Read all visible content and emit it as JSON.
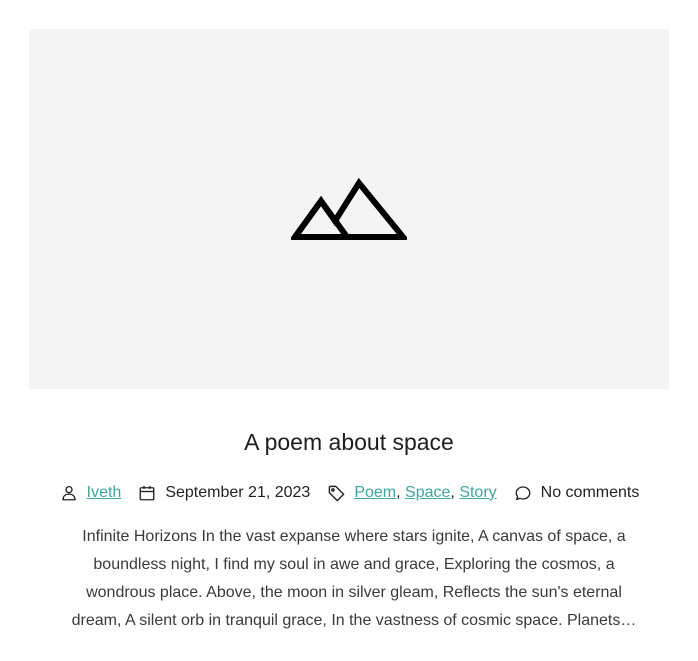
{
  "featured_image": {
    "icon": "mountains-placeholder-icon",
    "background": "#f4f4f4"
  },
  "post": {
    "title": "A poem about space",
    "author": "Iveth",
    "date": "September 21, 2023",
    "tags": [
      "Poem",
      "Space",
      "Story"
    ],
    "tag_separator": ",",
    "comments": "No comments",
    "excerpt": "Infinite Horizons In the vast expanse where stars ignite, A canvas of space, a boundless night, I find my soul in awe and grace, Exploring the cosmos, a wondrous place. Above, the moon in silver gleam, Reflects the sun's eternal dream, A silent orb in tranquil grace, In the vastness of cosmic space. Planets…"
  },
  "colors": {
    "link": "#3aa8a0",
    "text": "#222222"
  }
}
